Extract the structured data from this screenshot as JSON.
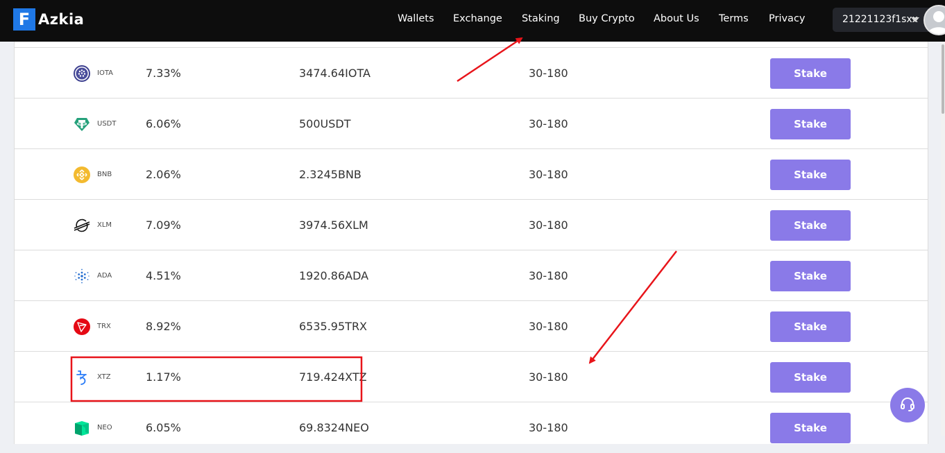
{
  "brand": {
    "mark": "F",
    "name": "Azkia",
    "mark_color": "#1f78e6"
  },
  "nav": {
    "items": [
      {
        "label": "Wallets"
      },
      {
        "label": "Exchange"
      },
      {
        "label": "Staking"
      },
      {
        "label": "Buy Crypto"
      },
      {
        "label": "About Us"
      },
      {
        "label": "Terms"
      },
      {
        "label": "Privacy"
      }
    ]
  },
  "user": {
    "name": "21221123f1sxx",
    "avatar_icon": "user-avatar-icon"
  },
  "staking_rows": [
    {
      "symbol": "IOTA",
      "rate": "7.33%",
      "amount": "3474.64IOTA",
      "days": "30-180",
      "button": "Stake",
      "icon": "iota-icon"
    },
    {
      "symbol": "USDT",
      "rate": "6.06%",
      "amount": "500USDT",
      "days": "30-180",
      "button": "Stake",
      "icon": "tether-icon"
    },
    {
      "symbol": "BNB",
      "rate": "2.06%",
      "amount": "2.3245BNB",
      "days": "30-180",
      "button": "Stake",
      "icon": "bnb-icon"
    },
    {
      "symbol": "XLM",
      "rate": "7.09%",
      "amount": "3974.56XLM",
      "days": "30-180",
      "button": "Stake",
      "icon": "stellar-icon"
    },
    {
      "symbol": "ADA",
      "rate": "4.51%",
      "amount": "1920.86ADA",
      "days": "30-180",
      "button": "Stake",
      "icon": "cardano-icon"
    },
    {
      "symbol": "TRX",
      "rate": "8.92%",
      "amount": "6535.95TRX",
      "days": "30-180",
      "button": "Stake",
      "icon": "tron-icon"
    },
    {
      "symbol": "XTZ",
      "rate": "1.17%",
      "amount": "719.424XTZ",
      "days": "30-180",
      "button": "Stake",
      "icon": "tezos-icon"
    },
    {
      "symbol": "NEO",
      "rate": "6.05%",
      "amount": "69.8324NEO",
      "days": "30-180",
      "button": "Stake",
      "icon": "neo-icon"
    }
  ],
  "colors": {
    "stake_button": "#8a7ae8",
    "navbar": "#0d0d0d",
    "annotation": "#e8141a"
  },
  "support": {
    "icon": "headset-icon"
  }
}
